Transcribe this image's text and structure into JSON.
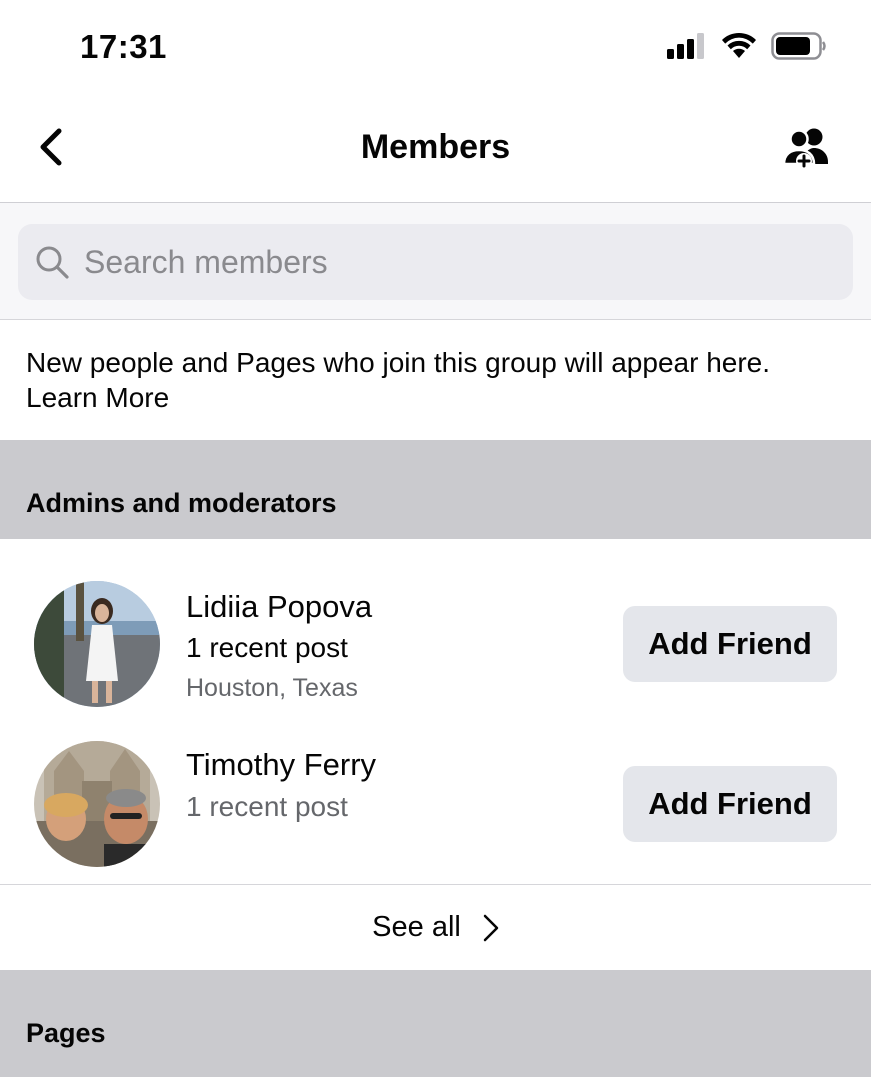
{
  "status_bar": {
    "time": "17:31"
  },
  "nav": {
    "title": "Members"
  },
  "search": {
    "placeholder": "Search members"
  },
  "info": {
    "text": "New people and Pages who join this group will appear here.",
    "link": "Learn More"
  },
  "sections": {
    "admins_title": "Admins and moderators",
    "pages_title": "Pages"
  },
  "members": [
    {
      "name": "Lidiia Popova",
      "posts": "1 recent post",
      "location": "Houston, Texas",
      "button": "Add Friend"
    },
    {
      "name": "Timothy Ferry",
      "posts": "1 recent post",
      "button": "Add Friend"
    }
  ],
  "see_all": {
    "label": "See all"
  },
  "colors": {
    "section_bg": "#cacace",
    "button_bg": "#e4e6eb",
    "search_bg": "#ebebf0",
    "secondary_text": "#65676b"
  },
  "icons": {
    "back": "chevron-left-icon",
    "nav_action": "add-people-icon",
    "search": "search-icon",
    "see_all": "chevron-right-icon"
  }
}
